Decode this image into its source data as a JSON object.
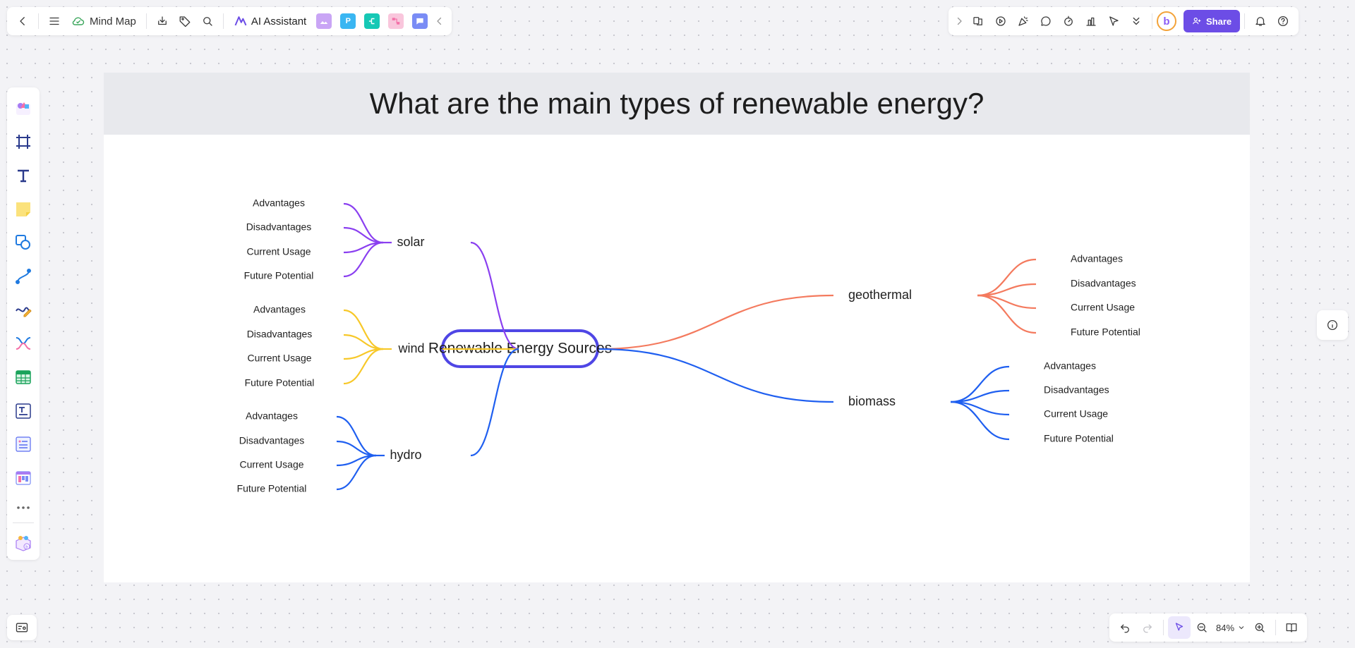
{
  "topbar": {
    "doc_title": "Mind Map",
    "ai_label": "AI Assistant",
    "plugins": [
      {
        "name": "image-ai",
        "color": "#c9a5f5",
        "glyph": ""
      },
      {
        "name": "presentation",
        "color": "#3ab6f2",
        "glyph": "P"
      },
      {
        "name": "flow",
        "color": "#16c8b5",
        "glyph": ""
      },
      {
        "name": "mindmap",
        "color": "#f46fa7",
        "glyph": ""
      },
      {
        "name": "chat",
        "color": "#7a8cf5",
        "glyph": ""
      }
    ]
  },
  "right_toolbar": {
    "share_label": "Share",
    "avatar_letter": "b"
  },
  "frame": {
    "title": "What are the main types of renewable energy?"
  },
  "mindmap": {
    "root": "Renewable Energy Sources",
    "branches": [
      {
        "label": "solar",
        "color": "#8a3ff0",
        "children": [
          "Advantages",
          "Disadvantages",
          "Current Usage",
          "Future Potential"
        ]
      },
      {
        "label": "wind",
        "color": "#f7c829",
        "children": [
          "Advantages",
          "Disadvantages",
          "Current Usage",
          "Future Potential"
        ]
      },
      {
        "label": "hydro",
        "color": "#1f5ff0",
        "children": [
          "Advantages",
          "Disadvantages",
          "Current Usage",
          "Future Potential"
        ]
      },
      {
        "label": "geothermal",
        "color": "#f47a5e",
        "children": [
          "Advantages",
          "Disadvantages",
          "Current Usage",
          "Future Potential"
        ]
      },
      {
        "label": "biomass",
        "color": "#1f5ff0",
        "children": [
          "Advantages",
          "Disadvantages",
          "Current Usage",
          "Future Potential"
        ]
      }
    ],
    "root_border_color": "#4f46e5"
  },
  "zoom": {
    "level": "84%"
  }
}
